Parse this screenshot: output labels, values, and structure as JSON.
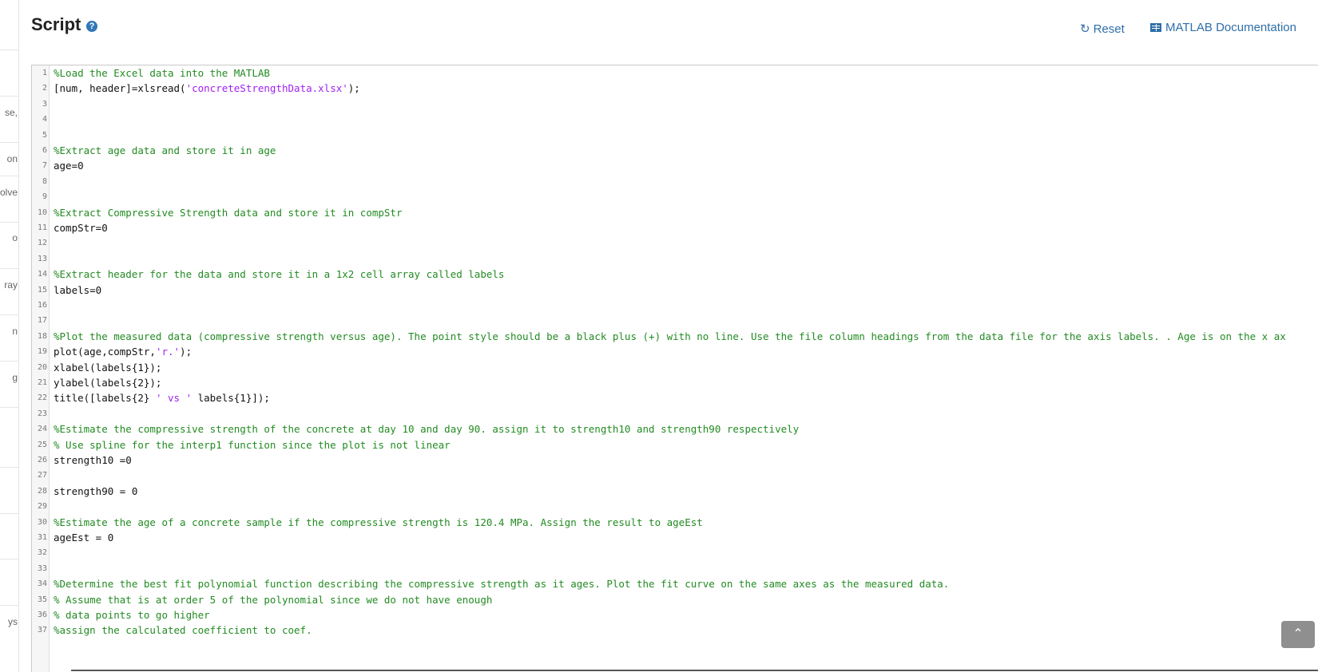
{
  "header": {
    "title": "Script",
    "help_icon": "?",
    "reset_label": "Reset",
    "docs_label": "MATLAB Documentation"
  },
  "left_strip": [
    "se,",
    "on",
    "olve",
    "o",
    "ray",
    "n",
    "g",
    "ys"
  ],
  "editor": {
    "lines": [
      {
        "n": "1",
        "p": [
          {
            "t": "%Load the Excel data into the MATLAB",
            "c": "c"
          }
        ]
      },
      {
        "n": "2",
        "p": [
          {
            "t": "[num, header]=xlsread(",
            "c": ""
          },
          {
            "t": "'concreteStrengthData.xlsx'",
            "c": "s"
          },
          {
            "t": ");",
            "c": ""
          }
        ]
      },
      {
        "n": "3",
        "p": []
      },
      {
        "n": "4",
        "p": []
      },
      {
        "n": "5",
        "p": []
      },
      {
        "n": "6",
        "p": [
          {
            "t": "%Extract age data and store it in age",
            "c": "c"
          }
        ]
      },
      {
        "n": "7",
        "p": [
          {
            "t": "age=0",
            "c": ""
          }
        ]
      },
      {
        "n": "8",
        "p": []
      },
      {
        "n": "9",
        "p": []
      },
      {
        "n": "10",
        "p": [
          {
            "t": "%Extract Compressive Strength data and store it in compStr",
            "c": "c"
          }
        ]
      },
      {
        "n": "11",
        "p": [
          {
            "t": "compStr=0",
            "c": ""
          }
        ]
      },
      {
        "n": "12",
        "p": []
      },
      {
        "n": "13",
        "p": []
      },
      {
        "n": "14",
        "p": [
          {
            "t": "%Extract header for the data and store it in a 1x2 cell array called labels",
            "c": "c"
          }
        ]
      },
      {
        "n": "15",
        "p": [
          {
            "t": "labels=0",
            "c": ""
          }
        ]
      },
      {
        "n": "16",
        "p": []
      },
      {
        "n": "17",
        "p": []
      },
      {
        "n": "18",
        "p": [
          {
            "t": "%Plot the measured data (compressive strength versus age). The point style should be a black plus (+) with no line. Use the file column headings from the data file for the axis labels. . Age is on the x ax",
            "c": "c"
          }
        ]
      },
      {
        "n": "19",
        "p": [
          {
            "t": "plot(age,compStr,",
            "c": ""
          },
          {
            "t": "'r.'",
            "c": "s"
          },
          {
            "t": ");",
            "c": ""
          }
        ]
      },
      {
        "n": "20",
        "p": [
          {
            "t": "xlabel(labels{1});",
            "c": ""
          }
        ]
      },
      {
        "n": "21",
        "p": [
          {
            "t": "ylabel(labels{2});",
            "c": ""
          }
        ]
      },
      {
        "n": "22",
        "p": [
          {
            "t": "title([labels{2} ",
            "c": ""
          },
          {
            "t": "' vs '",
            "c": "s"
          },
          {
            "t": " labels{1}]);",
            "c": ""
          }
        ]
      },
      {
        "n": "23",
        "p": []
      },
      {
        "n": "24",
        "p": [
          {
            "t": "%Estimate the compressive strength of the concrete at day 10 and day 90. assign it to strength10 and strength90 respectively",
            "c": "c"
          }
        ]
      },
      {
        "n": "25",
        "p": [
          {
            "t": "% Use spline for the interp1 function since the plot is not linear",
            "c": "c"
          }
        ]
      },
      {
        "n": "26",
        "p": [
          {
            "t": "strength10 =0",
            "c": ""
          }
        ]
      },
      {
        "n": "27",
        "p": []
      },
      {
        "n": "28",
        "p": [
          {
            "t": "strength90 = 0",
            "c": ""
          }
        ]
      },
      {
        "n": "29",
        "p": []
      },
      {
        "n": "30",
        "p": [
          {
            "t": "%Estimate the age of a concrete sample if the compressive strength is 120.4 MPa. Assign the result to ageEst",
            "c": "c"
          }
        ]
      },
      {
        "n": "31",
        "p": [
          {
            "t": "ageEst = 0",
            "c": ""
          }
        ]
      },
      {
        "n": "32",
        "p": []
      },
      {
        "n": "33",
        "p": []
      },
      {
        "n": "34",
        "p": [
          {
            "t": "%Determine the best fit polynomial function describing the compressive strength as it ages. Plot the fit curve on the same axes as the measured data.",
            "c": "c"
          }
        ]
      },
      {
        "n": "35",
        "p": [
          {
            "t": "% Assume that is at order 5 of the polynomial since we do not have enough",
            "c": "c"
          }
        ]
      },
      {
        "n": "36",
        "p": [
          {
            "t": "% data points to go higher",
            "c": "c"
          }
        ]
      },
      {
        "n": "37",
        "p": [
          {
            "t": "%assign the calculated coefficient to coef.",
            "c": "c"
          }
        ]
      }
    ]
  },
  "scroll_top_icon": "chevron-up-icon"
}
